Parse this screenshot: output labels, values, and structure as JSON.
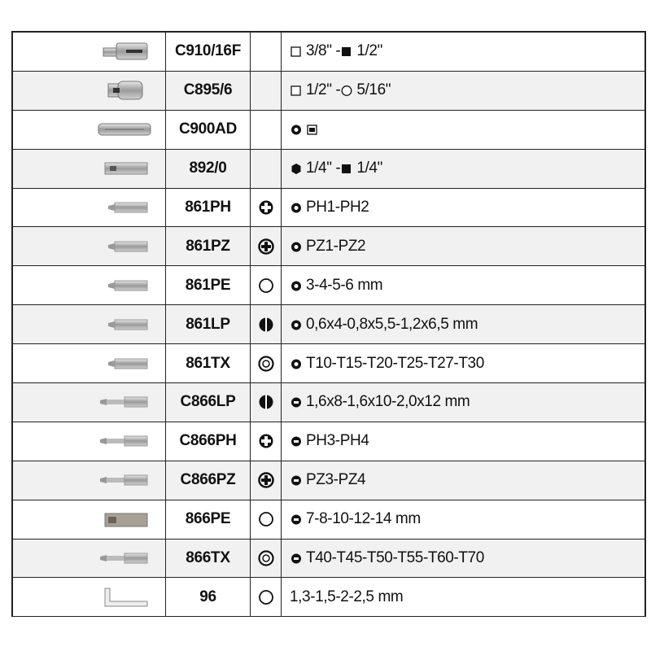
{
  "rows": [
    {
      "code": "C910/16F",
      "tool": "adapter-female",
      "type_icon": "",
      "desc_icon": "",
      "desc_parts": [
        {
          "icon": "square-open",
          "text": "3/8\" - "
        },
        {
          "icon": "square-filled",
          "text": "1/2\""
        }
      ]
    },
    {
      "code": "C895/6",
      "tool": "adapter-socket",
      "type_icon": "",
      "desc_icon": "",
      "desc_parts": [
        {
          "icon": "square-open",
          "text": "1/2\" - "
        },
        {
          "icon": "hexagon-open",
          "text": "5/16\""
        }
      ]
    },
    {
      "code": "C900AD",
      "tool": "bit-holder",
      "type_icon": "",
      "desc_icon": "",
      "desc_parts": [
        {
          "icon": "bit-marker",
          "text": ""
        },
        {
          "icon": "impact-marker",
          "text": ""
        }
      ]
    },
    {
      "code": "892/0",
      "tool": "adapter-hex",
      "type_icon": "",
      "desc_icon": "",
      "desc_parts": [
        {
          "icon": "hexagon-filled",
          "text": "1/4\" - "
        },
        {
          "icon": "square-filled",
          "text": "1/4\""
        }
      ]
    },
    {
      "code": "861PH",
      "tool": "bit-short",
      "type_icon": "phillips-icon",
      "desc_icon": "bit-marker",
      "desc": "PH1-PH2"
    },
    {
      "code": "861PZ",
      "tool": "bit-short",
      "type_icon": "pozidriv-icon",
      "desc_icon": "bit-marker",
      "desc": "PZ1-PZ2"
    },
    {
      "code": "861PE",
      "tool": "bit-short",
      "type_icon": "hex-icon",
      "desc_icon": "bit-marker",
      "desc": "3-4-5-6 mm"
    },
    {
      "code": "861LP",
      "tool": "bit-short",
      "type_icon": "slotted-icon",
      "desc_icon": "bit-marker",
      "desc": "0,6x4-0,8x5,5-1,2x6,5 mm"
    },
    {
      "code": "861TX",
      "tool": "bit-short",
      "type_icon": "torx-icon",
      "desc_icon": "bit-marker",
      "desc": "T10-T15-T20-T25-T27-T30"
    },
    {
      "code": "C866LP",
      "tool": "bit-long",
      "type_icon": "slotted-icon",
      "desc_icon": "long-bit-marker",
      "desc": "1,6x8-1,6x10-2,0x12 mm"
    },
    {
      "code": "C866PH",
      "tool": "bit-long",
      "type_icon": "phillips-icon",
      "desc_icon": "long-bit-marker",
      "desc": "PH3-PH4"
    },
    {
      "code": "C866PZ",
      "tool": "bit-long",
      "type_icon": "pozidriv-icon",
      "desc_icon": "long-bit-marker",
      "desc": "PZ3-PZ4"
    },
    {
      "code": "866PE",
      "tool": "bit-hex-long",
      "type_icon": "hex-icon",
      "desc_icon": "long-bit-marker",
      "desc": "7-8-10-12-14 mm"
    },
    {
      "code": "866TX",
      "tool": "bit-long",
      "type_icon": "torx-icon",
      "desc_icon": "long-bit-marker",
      "desc": "T40-T45-T50-T55-T60-T70"
    },
    {
      "code": "96",
      "tool": "hex-key",
      "type_icon": "hex-icon",
      "desc_icon": "",
      "desc": "1,3-1,5-2-2,5 mm"
    }
  ]
}
